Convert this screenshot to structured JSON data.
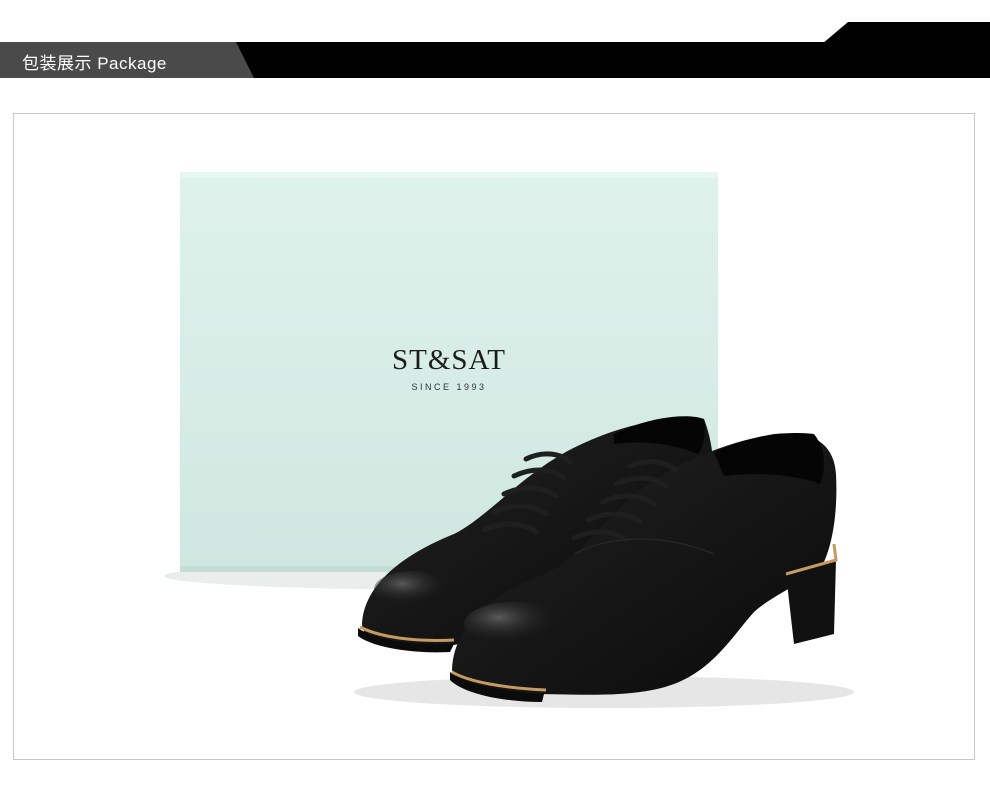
{
  "header": {
    "title": "包装展示 Package"
  },
  "product_photo": {
    "box": {
      "logo_text": "ST&SAT",
      "tagline": "SINCE 1993",
      "color": "#d6ece6"
    },
    "shoes": {
      "color": "#141414",
      "trim_color": "#c59a63"
    }
  }
}
